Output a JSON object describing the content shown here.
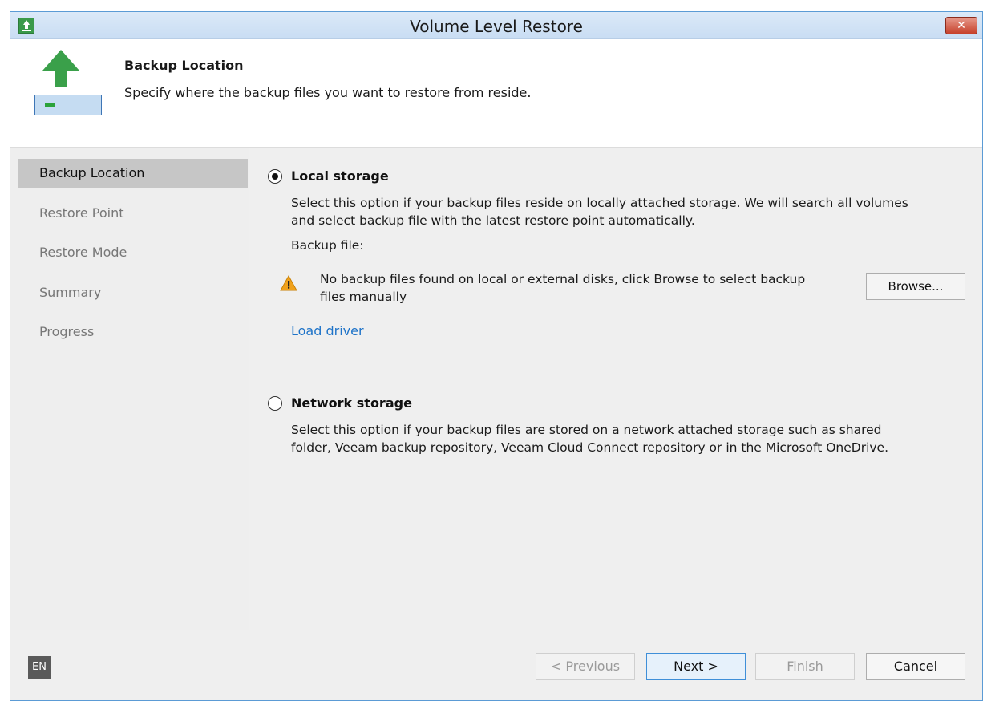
{
  "window": {
    "title": "Volume Level Restore",
    "close_glyph": "✕"
  },
  "header": {
    "title": "Backup Location",
    "subtitle": "Specify where the backup files you want to restore from reside."
  },
  "sidebar": {
    "items": [
      {
        "label": "Backup Location",
        "active": true
      },
      {
        "label": "Restore Point",
        "active": false
      },
      {
        "label": "Restore Mode",
        "active": false
      },
      {
        "label": "Summary",
        "active": false
      },
      {
        "label": "Progress",
        "active": false
      }
    ]
  },
  "local": {
    "label": "Local storage",
    "selected": true,
    "description_line1": "Select this option if your backup files reside on locally attached storage. We will search all volumes",
    "description_line2": "and select backup file with the latest restore point automatically.",
    "backup_file_label": "Backup file:",
    "warning_line1": "No backup files found on local or external disks, click Browse to select backup",
    "warning_line2": "files manually",
    "browse_label": "Browse...",
    "load_driver_label": "Load driver"
  },
  "network": {
    "label": "Network storage",
    "selected": false,
    "description_line1": "Select this option if your backup files are stored on a network attached storage such as shared",
    "description_line2": "folder, Veeam backup repository, Veeam Cloud Connect repository or in the Microsoft OneDrive."
  },
  "footer": {
    "language": "EN",
    "previous_label": "< Previous",
    "next_label": "Next >",
    "finish_label": "Finish",
    "cancel_label": "Cancel"
  },
  "colors": {
    "accent": "#1e73c8",
    "success": "#3aa04a",
    "warning": "#f0a11b"
  }
}
